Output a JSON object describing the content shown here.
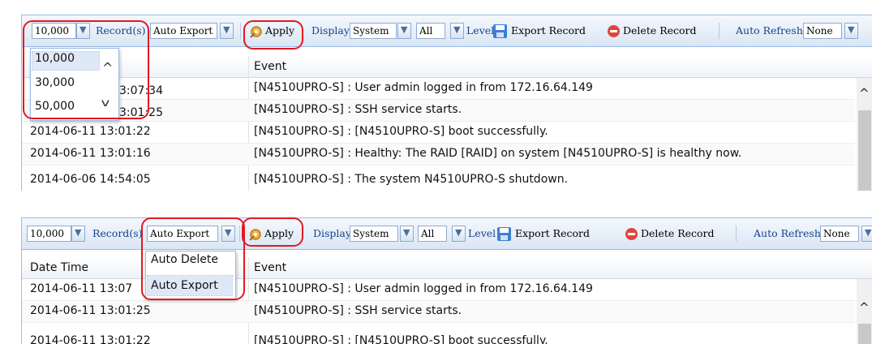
{
  "toolbar": {
    "records_value": "10,000",
    "records_label": "Record(s)",
    "action_value": "Auto Export",
    "apply_label": "Apply",
    "display_label": "Display",
    "display_value": "System",
    "level_value": "All",
    "level_label": "Level",
    "export_label": "Export Record",
    "delete_label": "Delete Record",
    "refresh_label": "Auto Refresh",
    "refresh_value": "None"
  },
  "grid": {
    "col_datetime": "Date Time",
    "col_event": "Event",
    "rows": [
      {
        "datetime": "2014-06-11 13:07:34",
        "event": "[N4510UPRO-S] : User admin logged in from 172.16.64.149"
      },
      {
        "datetime": "2014-06-11 13:01:25",
        "event": "[N4510UPRO-S] : SSH service starts."
      },
      {
        "datetime": "2014-06-11 13:01:22",
        "event": "[N4510UPRO-S] : [N4510UPRO-S] boot successfully."
      },
      {
        "datetime": "2014-06-11 13:01:16",
        "event": "[N4510UPRO-S] : Healthy: The RAID [RAID] on system [N4510UPRO-S] is healthy now."
      },
      {
        "datetime": "2014-06-06 14:54:05",
        "event": "[N4510UPRO-S] : The system N4510UPRO-S shutdown."
      }
    ]
  },
  "records_dropdown": {
    "options": [
      "10,000",
      "30,000",
      "50,000"
    ],
    "visible_row_tails": [
      "3:07:34",
      "3:01:25"
    ]
  },
  "action_dropdown": {
    "options": [
      "Auto Delete",
      "Auto Export"
    ],
    "visible_row_tail": "2014-06-11 13:07"
  },
  "colors": {
    "callout": "#e3191f",
    "toolbar_text": "#15428b",
    "border": "#99bbe8"
  }
}
